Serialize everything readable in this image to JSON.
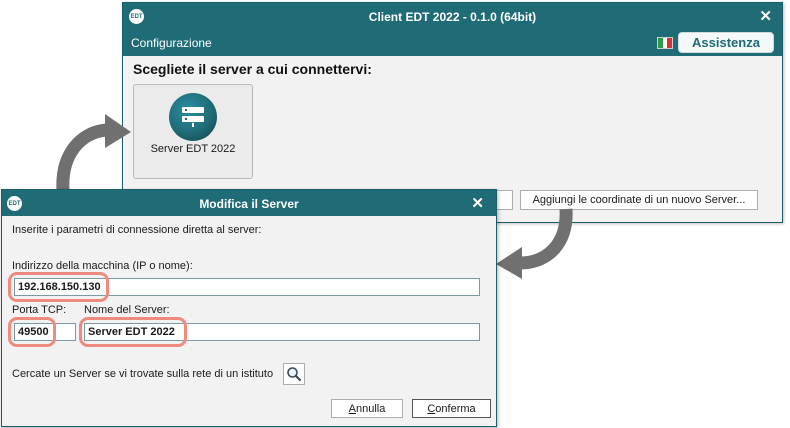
{
  "client_window": {
    "logo": "EDT",
    "title": "Client EDT 2022 - 0.1.0 (64bit)",
    "close_glyph": "✕",
    "menu_label": "Configurazione",
    "assist_label": "Assistenza",
    "heading": "Scegliete il server a cui connettervi:",
    "server_tile_label": "Server EDT 2022",
    "add_server_label": "Aggiungi le coordinate di un nuovo Server..."
  },
  "dialog": {
    "logo": "EDT",
    "title": "Modifica il Server",
    "close_glyph": "✕",
    "intro": "Inserite i parametri di connessione diretta al server:",
    "address_label": "Indirizzo della macchina (IP o nome):",
    "address_value": "192.168.150.130",
    "port_label": "Porta TCP:",
    "port_value": "49500",
    "server_name_label": "Nome del Server:",
    "server_name_value": "Server EDT 2022",
    "search_hint": "Cercate un Server se vi trovate sulla rete di un istituto",
    "cancel_first": "A",
    "cancel_rest": "nnulla",
    "confirm_first": "C",
    "confirm_rest": "onferma"
  },
  "colors": {
    "titlebar": "#1f6b76",
    "highlight": "#ef8a7e",
    "arrow": "#707070",
    "flag_green": "#2f9a46",
    "flag_white": "#ffffff",
    "flag_red": "#d2323a"
  },
  "icons": [
    "edt-logo-icon",
    "close-icon",
    "italy-flag-icon",
    "server-icon",
    "search-icon",
    "curved-arrow-icon"
  ]
}
